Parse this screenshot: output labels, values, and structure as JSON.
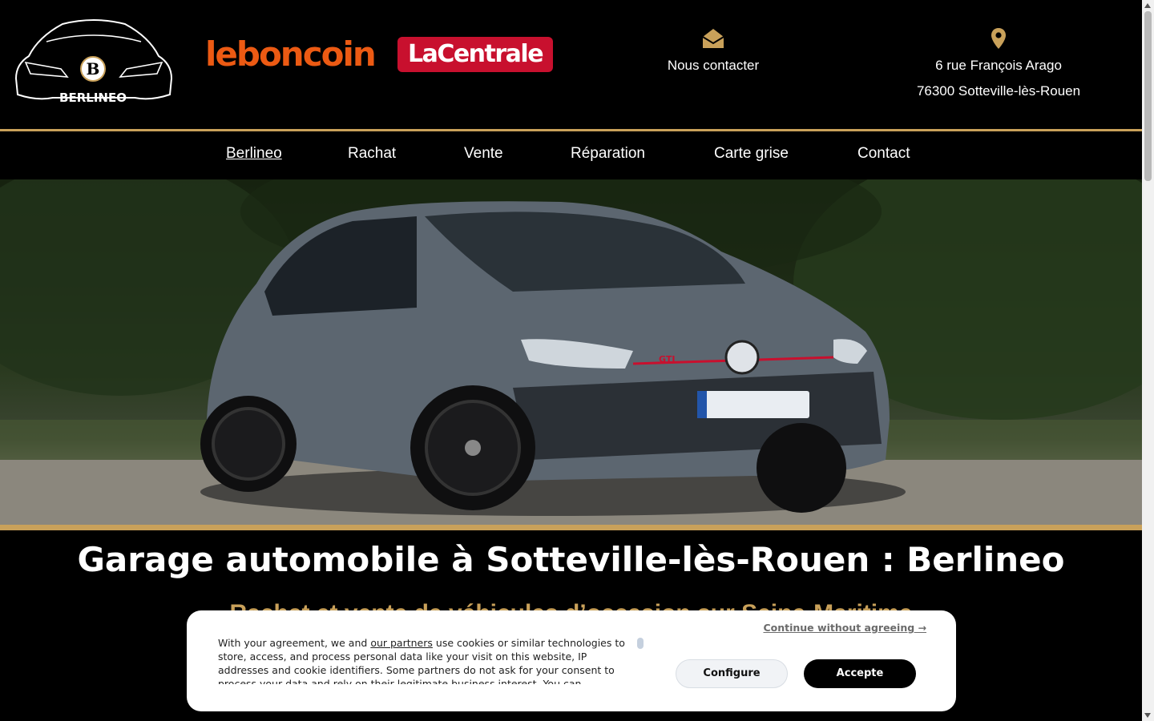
{
  "header": {
    "logo_text": "BERLINEO",
    "logo_letter": "B",
    "leboncoin": "leboncoin",
    "lacentrale": "LaCentrale",
    "contact_label": "Nous contacter",
    "address_line1": "6 rue François Arago",
    "address_line2": "76300 Sotteville-lès-Rouen",
    "contact_icon": "envelope-open-icon",
    "address_icon": "map-pin-icon"
  },
  "nav": {
    "items": [
      {
        "label": "Berlineo",
        "active": true
      },
      {
        "label": "Rachat"
      },
      {
        "label": "Vente"
      },
      {
        "label": "Réparation"
      },
      {
        "label": "Carte grise"
      },
      {
        "label": "Contact"
      }
    ]
  },
  "hero": {
    "plate_badge": "GTI"
  },
  "main": {
    "title": "Garage automobile à Sotteville-lès-Rouen : Berlineo",
    "subtitle": "Rachat et vente de véhicules d’occasion sur Seine-Maritime"
  },
  "cookie": {
    "text_before": "With your agreement, we and",
    "partners_link": "our partners",
    "text_after": "use cookies or similar technologies to store, access, and process personal data like your visit on this website, IP addresses and cookie identifiers. Some partners do not ask for your consent to process your data and rely on their legitimate business interest. You can",
    "continue_label": "Continue without agreeing →",
    "configure_label": "Configure",
    "accept_label": "Accepte"
  },
  "colors": {
    "gold": "#c9a15a",
    "leboncoin_orange": "#ec5a13",
    "lacentrale_red": "#c8102e"
  }
}
